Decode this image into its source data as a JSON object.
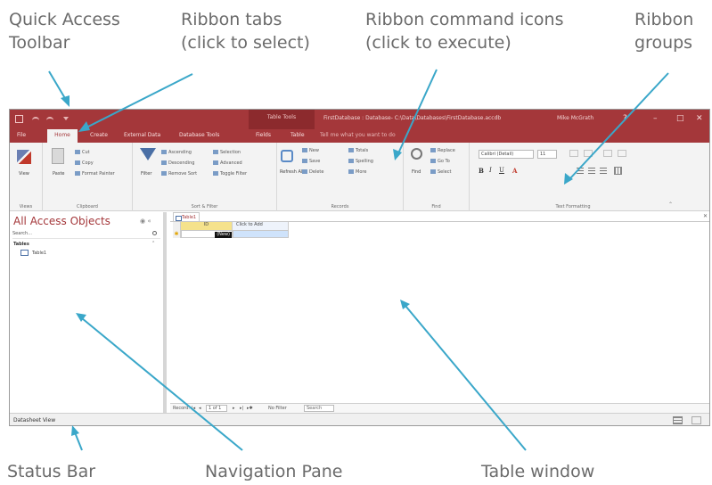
{
  "callouts": {
    "qat": [
      "Quick Access",
      "Toolbar"
    ],
    "tabs": [
      "Ribbon tabs",
      "(click to select)"
    ],
    "commands": [
      "Ribbon command icons",
      "(click to execute)"
    ],
    "groups": [
      "Ribbon",
      "groups"
    ],
    "status": "Status Bar",
    "nav": "Navigation Pane",
    "table": "Table window"
  },
  "titlebar": {
    "context_tab": "Table Tools",
    "title": "FirstDatabase : Database- C:\\Data\\Databases\\FirstDatabase.accdb",
    "user": "Mike McGrath",
    "help": "?",
    "minimize": "–",
    "maximize": "□",
    "close": "✕"
  },
  "ribbon_tabs": [
    "File",
    "Home",
    "Create",
    "External Data",
    "Database Tools",
    "Fields",
    "Table",
    "Tell me what you want to do"
  ],
  "ribbon": {
    "groups": [
      "Views",
      "Clipboard",
      "Sort & Filter",
      "Records",
      "Find",
      "Text Formatting"
    ],
    "views": {
      "view": "View"
    },
    "clipboard": {
      "paste": "Paste",
      "cut": "Cut",
      "copy": "Copy",
      "format_painter": "Format Painter"
    },
    "sort_filter": {
      "filter": "Filter",
      "ascending": "Ascending",
      "descending": "Descending",
      "remove_sort": "Remove Sort",
      "selection": "Selection",
      "advanced": "Advanced",
      "toggle_filter": "Toggle Filter"
    },
    "records": {
      "refresh": "Refresh All",
      "new": "New",
      "save": "Save",
      "delete": "Delete",
      "totals": "Totals",
      "spelling": "Spelling",
      "more": "More"
    },
    "find": {
      "find": "Find",
      "replace": "Replace",
      "goto": "Go To",
      "select": "Select"
    },
    "text_formatting": {
      "font": "Calibri (Detail)",
      "size": "11",
      "bold": "B",
      "italic": "I",
      "underline": "U",
      "font_color": "A"
    }
  },
  "nav_pane": {
    "title": "All Access Objects",
    "controls": "◉ «",
    "search_placeholder": "Search...",
    "section": "Tables",
    "section_chevron": "⌃",
    "items": [
      "Table1"
    ]
  },
  "table_window": {
    "tab": "Table1",
    "close": "✕",
    "columns": [
      "ID",
      "Click to Add"
    ],
    "new_cell": "(New)",
    "row_marker": "✱"
  },
  "record_nav": {
    "label": "Record:",
    "first": "|◂",
    "prev": "◂",
    "position": "1 of 1",
    "next": "▸",
    "last": "▸|",
    "new": "▸✱",
    "filter": "No Filter",
    "search": "Search"
  },
  "status_bar": {
    "text": "Datasheet View"
  },
  "colors": {
    "access_red": "#a4373a",
    "callout_arrow": "#3aa7c9"
  }
}
